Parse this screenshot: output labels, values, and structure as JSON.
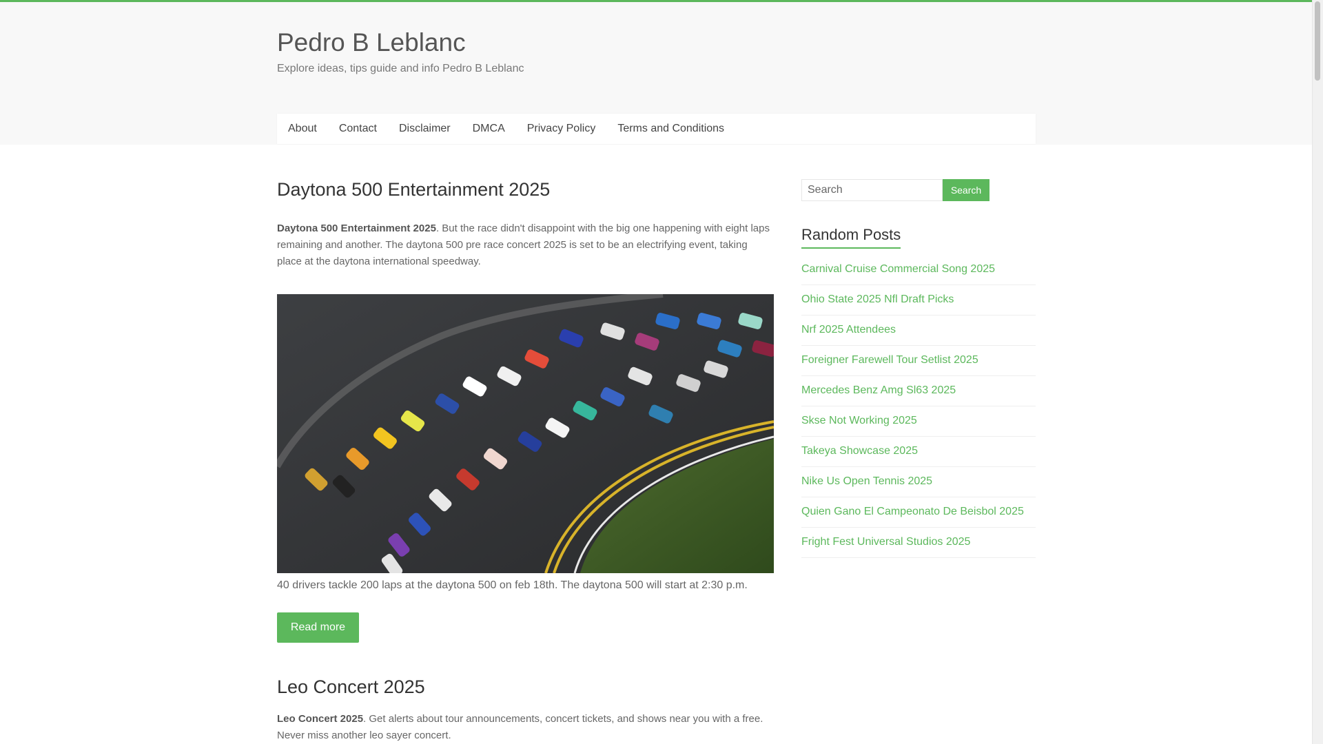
{
  "site": {
    "title": "Pedro B Leblanc",
    "description": "Explore ideas, tips guide and info Pedro B Leblanc"
  },
  "nav": {
    "items": [
      "About",
      "Contact",
      "Disclaimer",
      "DMCA",
      "Privacy Policy",
      "Terms and Conditions"
    ]
  },
  "posts": [
    {
      "title": "Daytona 500 Entertainment 2025",
      "excerpt_bold": "Daytona 500 Entertainment 2025",
      "excerpt_rest": ". But the race didn't disappoint with the big one happening with eight laps remaining and another. The daytona 500 pre race concert 2025 is set to be an electrifying event, taking place at the daytona international speedway.",
      "caption": "40 drivers tackle 200 laps at the daytona 500 on feb 18th. The daytona 500 will start at 2:30 p.m.",
      "read_more": "Read more"
    },
    {
      "title": "Leo Concert 2025",
      "excerpt_bold": "Leo Concert 2025",
      "excerpt_rest": ". Get alerts about tour announcements, concert tickets, and shows near you with a free. Never miss another leo sayer concert."
    }
  ],
  "sidebar": {
    "search_placeholder": "Search",
    "search_button": "Search",
    "random_posts_title": "Random Posts",
    "random_posts": [
      "Carnival Cruise Commercial Song 2025",
      "Ohio State 2025 Nfl Draft Picks",
      "Nrf 2025 Attendees",
      "Foreigner Farewell Tour Setlist 2025",
      "Mercedes Benz Amg Sl63 2025",
      "Skse Not Working 2025",
      "Takeya Showcase 2025",
      "Nike Us Open Tennis 2025",
      "Quien Gano El Campeonato De Beisbol 2025",
      "Fright Fest Universal Studios 2025"
    ]
  },
  "colors": {
    "accent": "#5cb85c",
    "background": "#f8f8f8"
  }
}
